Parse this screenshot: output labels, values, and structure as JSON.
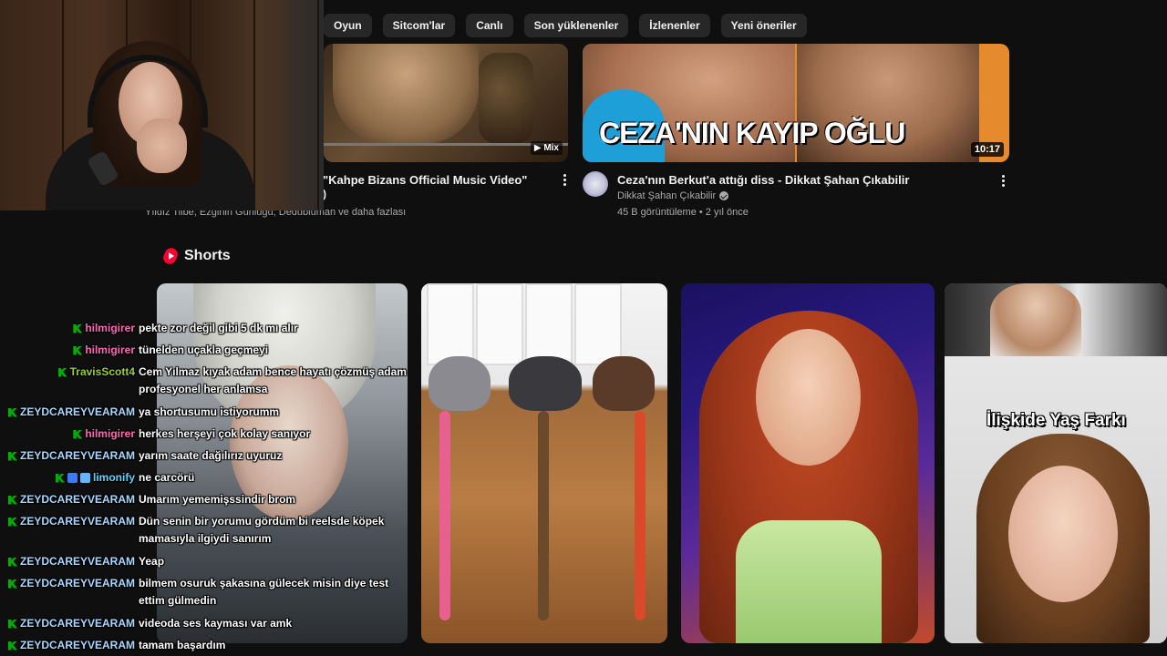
{
  "chips": [
    "Oyun",
    "Sitcom'lar",
    "Canlı",
    "Son yüklenenler",
    "İzlenenler",
    "Yeni öneriler"
  ],
  "video1": {
    "title_line1": "\"Kahpe Bizans Official Music Video\"",
    "title_line2": ")",
    "meta": "Yıldız Tilbe, Ezginin Günlüğü, Dedublüman ve daha fazlası",
    "badge": "Mix"
  },
  "video2": {
    "thumbnail_text": "CEZA'NIN KAYIP OĞLU",
    "duration": "10:17",
    "title": "Ceza'nın Berkut'a attığı diss - Dikkat Şahan Çıkabilir",
    "channel": "Dikkat Şahan Çıkabilir",
    "stats": "45 B görüntüleme • 2 yıl önce"
  },
  "shorts": {
    "heading": "Shorts",
    "short4_caption": "İlişkide Yaş Farkı"
  },
  "chat": [
    {
      "user": "hilmigirer",
      "color": "#ff69b4",
      "badges": [
        "mod"
      ],
      "text": "pekte zor değil gibi 5 dk mı alır"
    },
    {
      "user": "hilmigirer",
      "color": "#ff69b4",
      "badges": [
        "mod"
      ],
      "text": "tünelden uçakla geçmeyi"
    },
    {
      "user": "TravisScott4",
      "color": "#9acd32",
      "badges": [
        "mod"
      ],
      "text": "Cem Yılmaz kıyak adam bence hayatı çözmüş adam profesyonel her anlamsa"
    },
    {
      "user": "ZEYDCAREYVEARAM",
      "color": "#a8d8ff",
      "badges": [
        "mod"
      ],
      "text": "ya shortusumu istiyorumm"
    },
    {
      "user": "hilmigirer",
      "color": "#ff69b4",
      "badges": [
        "mod"
      ],
      "text": "herkes herşeyi çok kolay sanıyor"
    },
    {
      "user": "ZEYDCAREYVEARAM",
      "color": "#a8d8ff",
      "badges": [
        "mod"
      ],
      "text": "yarım saate dağılırız uyuruz"
    },
    {
      "user": "limonify",
      "color": "#5fd3ff",
      "badges": [
        "mod",
        "sub",
        "sub2"
      ],
      "text": "ne carcörü"
    },
    {
      "user": "ZEYDCAREYVEARAM",
      "color": "#a8d8ff",
      "badges": [
        "mod"
      ],
      "text": "Umarım yememişssindir brom"
    },
    {
      "user": "ZEYDCAREYVEARAM",
      "color": "#a8d8ff",
      "badges": [
        "mod"
      ],
      "text": "Dün senin bir yorumu gördüm bi reelsde köpek mamasıyla ilgiydi sanırım"
    },
    {
      "user": "ZEYDCAREYVEARAM",
      "color": "#a8d8ff",
      "badges": [
        "mod"
      ],
      "text": "Yeap"
    },
    {
      "user": "ZEYDCAREYVEARAM",
      "color": "#a8d8ff",
      "badges": [
        "mod"
      ],
      "text": "bilmem osuruk şakasına gülecek misin diye test ettim gülmedin"
    },
    {
      "user": "ZEYDCAREYVEARAM",
      "color": "#a8d8ff",
      "badges": [
        "mod"
      ],
      "text": "videoda ses kayması var amk"
    },
    {
      "user": "ZEYDCAREYVEARAM",
      "color": "#a8d8ff",
      "badges": [
        "mod"
      ],
      "text": "tamam başardım"
    }
  ]
}
